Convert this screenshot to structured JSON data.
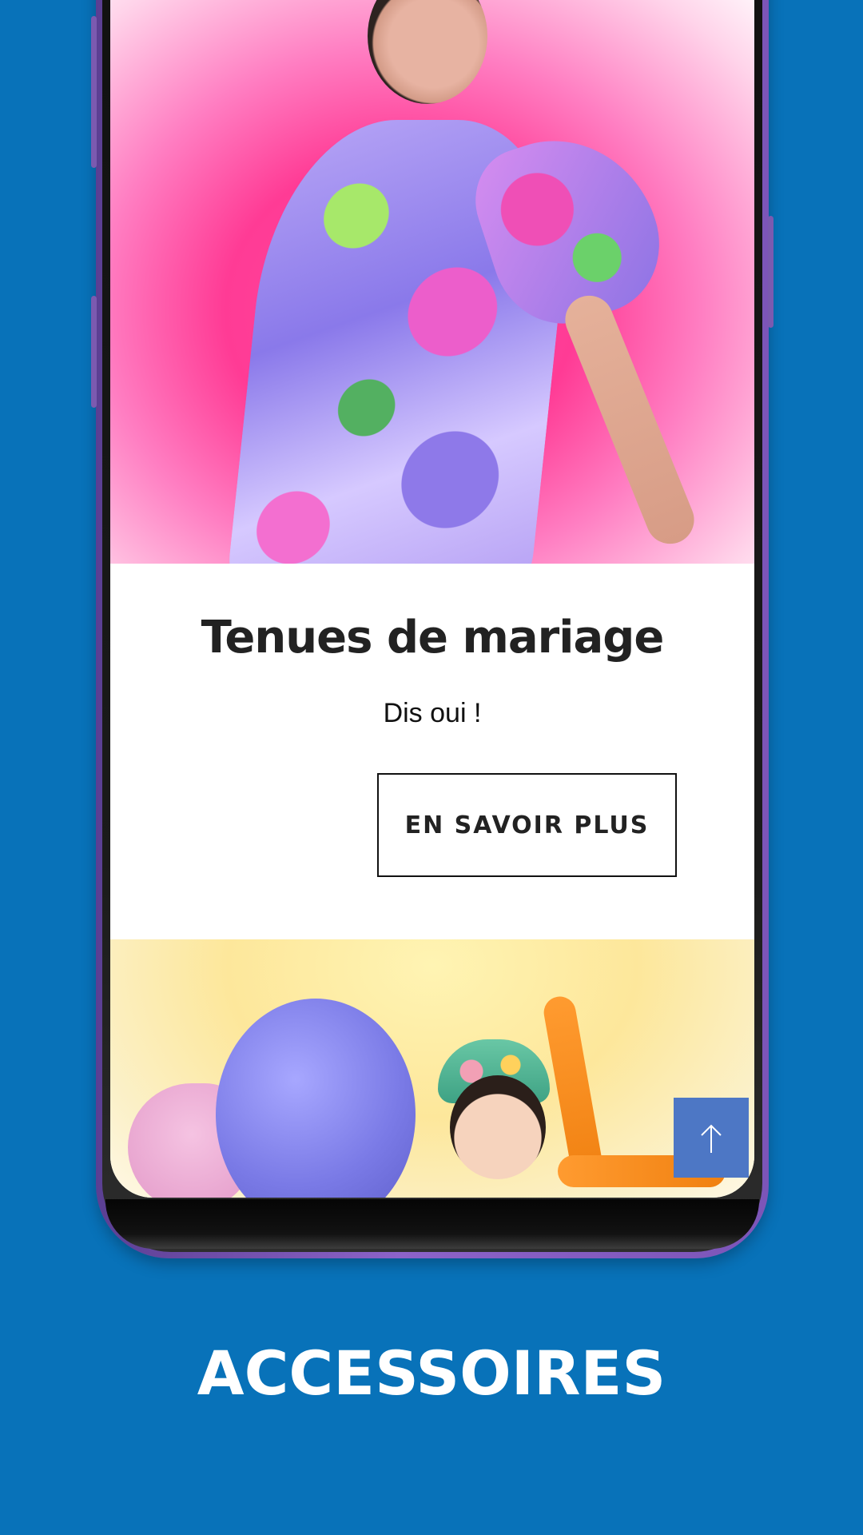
{
  "hero": {
    "image_name": "wedding-dress-photo"
  },
  "content": {
    "title": "Tenues de mariage",
    "subtitle": "Dis oui !",
    "cta_label": "EN SAVOIR PLUS"
  },
  "secondary_image": {
    "image_name": "child-accessories-photo"
  },
  "controls": {
    "back_to_top_icon": "arrow-up-icon"
  },
  "caption": {
    "text": "ACCESSOIRES"
  },
  "colors": {
    "background": "#0872b9",
    "phone_frame": "#7c55b8",
    "back_to_top": "#4d77c5",
    "text_dark": "#222222"
  }
}
